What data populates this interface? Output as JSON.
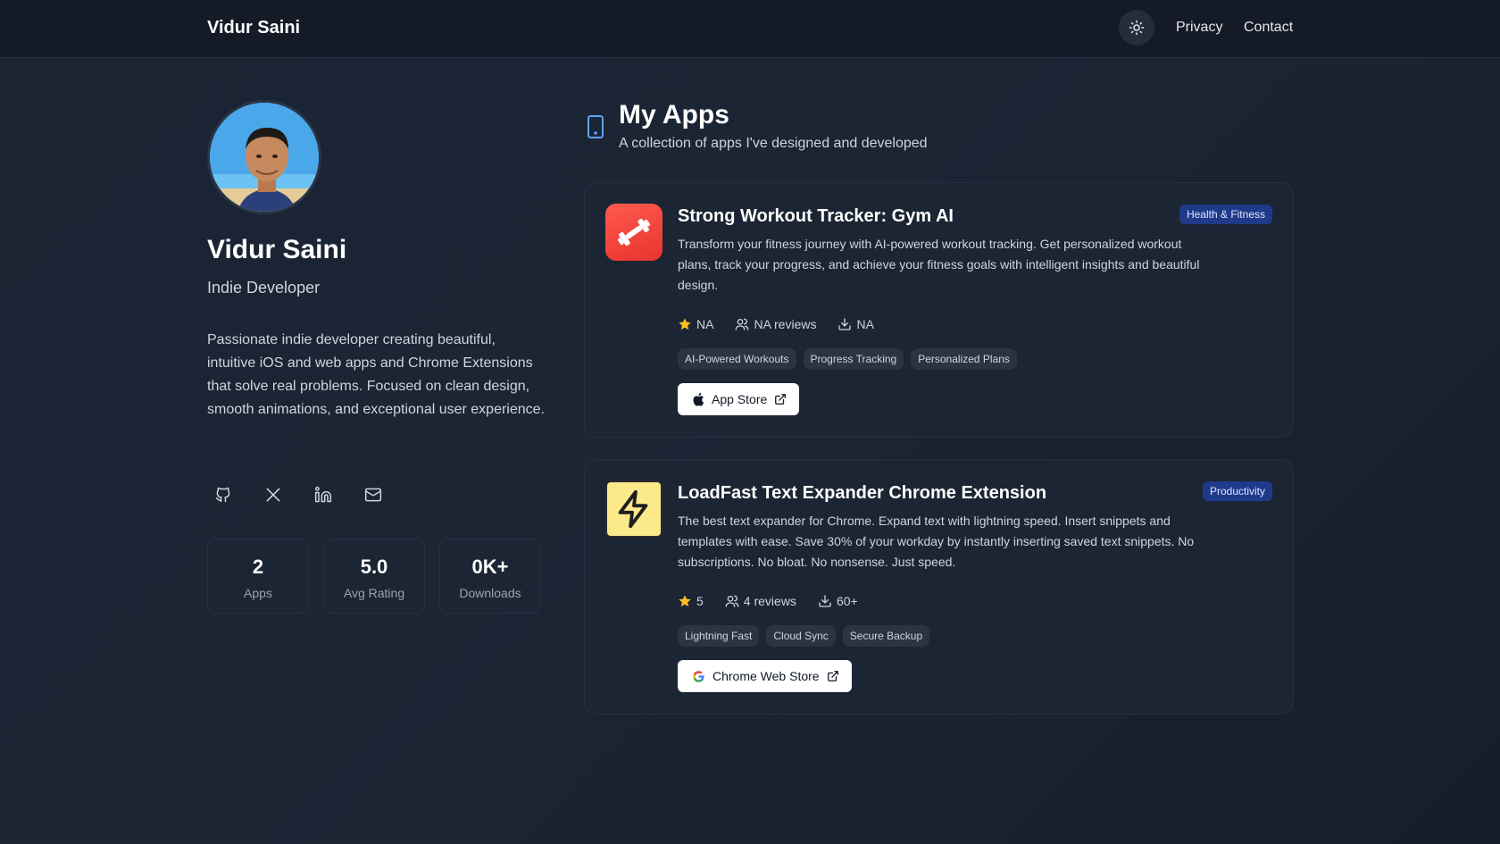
{
  "header": {
    "brand": "Vidur Saini",
    "theme_icon": "sun-icon",
    "nav": [
      "Privacy",
      "Contact"
    ]
  },
  "profile": {
    "name": "Vidur Saini",
    "role": "Indie Developer",
    "bio": "Passionate indie developer creating beautiful, intuitive iOS and web apps and Chrome Extensions that solve real problems. Focused on clean design, smooth animations, and exceptional user experience.",
    "socials": [
      "github-icon",
      "x-icon",
      "linkedin-icon",
      "mail-icon"
    ],
    "stats": [
      {
        "value": "2",
        "label": "Apps"
      },
      {
        "value": "5.0",
        "label": "Avg Rating"
      },
      {
        "value": "0K+",
        "label": "Downloads"
      }
    ]
  },
  "apps_section": {
    "title": "My Apps",
    "subtitle": "A collection of apps I've designed and developed"
  },
  "apps": [
    {
      "title": "Strong Workout Tracker: Gym AI",
      "category": "Health & Fitness",
      "description": "Transform your fitness journey with AI-powered workout tracking. Get personalized workout plans, track your progress, and achieve your fitness goals with intelligent insights and beautiful design.",
      "rating": "NA",
      "reviews": "NA reviews",
      "downloads": "NA",
      "tags": [
        "AI-Powered Workouts",
        "Progress Tracking",
        "Personalized Plans"
      ],
      "store_label": "App Store",
      "icon": "dumbbell-icon",
      "accent": "#f04438"
    },
    {
      "title": "LoadFast Text Expander Chrome Extension",
      "category": "Productivity",
      "description": "The best text expander for Chrome. Expand text with lightning speed. Insert snippets and templates with ease. Save 30% of your workday by instantly inserting saved text snippets. No subscriptions. No bloat. No nonsense. Just speed.",
      "rating": "5",
      "reviews": "4 reviews",
      "downloads": "60+",
      "tags": [
        "Lightning Fast",
        "Cloud Sync",
        "Secure Backup"
      ],
      "store_label": "Chrome Web Store",
      "icon": "lightning-icon",
      "accent": "#fbe98a"
    }
  ],
  "colors": {
    "badge_bg": "#1f3a8a",
    "star": "#fbbf24",
    "card_bg": "#1c2533"
  }
}
